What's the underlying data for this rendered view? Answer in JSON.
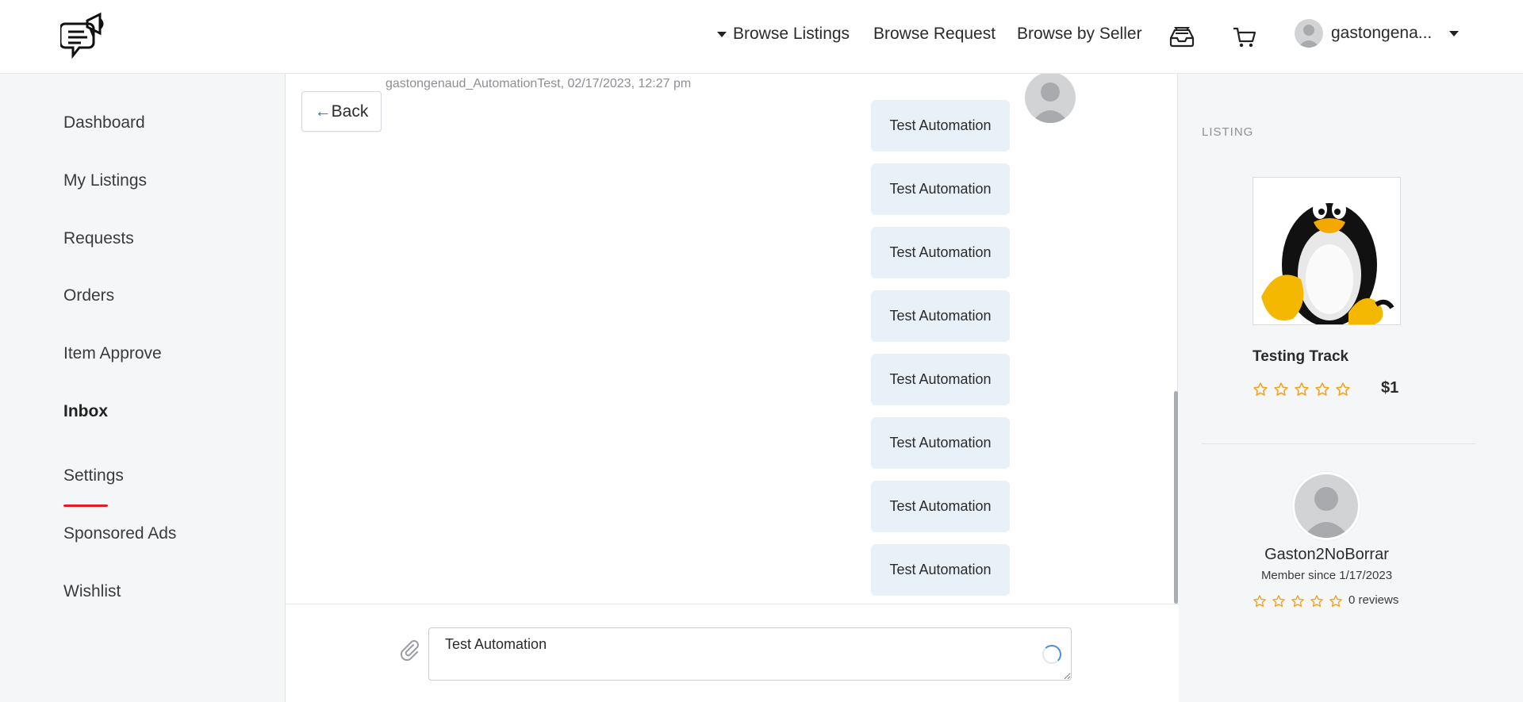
{
  "header": {
    "nav": {
      "browse_listings": "Browse Listings",
      "browse_request": "Browse Request",
      "browse_by_seller": "Browse by Seller"
    },
    "icons": [
      "inbox-tray-icon",
      "cart-icon"
    ],
    "user_name": "gastongena..."
  },
  "sidebar": {
    "items": [
      {
        "label": "Dashboard"
      },
      {
        "label": "My Listings"
      },
      {
        "label": "Requests"
      },
      {
        "label": "Orders"
      },
      {
        "label": "Item Approve"
      },
      {
        "label": "Inbox",
        "active": true
      },
      {
        "label": "Settings"
      },
      {
        "label": "Sponsored Ads"
      },
      {
        "label": "Wishlist"
      }
    ],
    "active_color": "#e02020"
  },
  "chat": {
    "back_label": "Back",
    "meta": "gastongenaud_AutomationTest, 02/17/2023, 12:27 pm",
    "messages": [
      "Test Automation",
      "Test Automation",
      "Test Automation",
      "Test Automation",
      "Test Automation",
      "Test Automation",
      "Test Automation",
      "Test Automation"
    ],
    "input_value": "Test Automation",
    "bubble_color": "#e9f1f8"
  },
  "listing": {
    "heading": "LISTING",
    "title": "Testing Track",
    "rating": 0,
    "price": "$1"
  },
  "seller": {
    "name": "Gaston2NoBorrar",
    "member_since": "Member since 1/17/2023",
    "rating": 0,
    "reviews": "0 reviews"
  },
  "colors": {
    "star": "#f0a020",
    "accent": "#e02020"
  }
}
